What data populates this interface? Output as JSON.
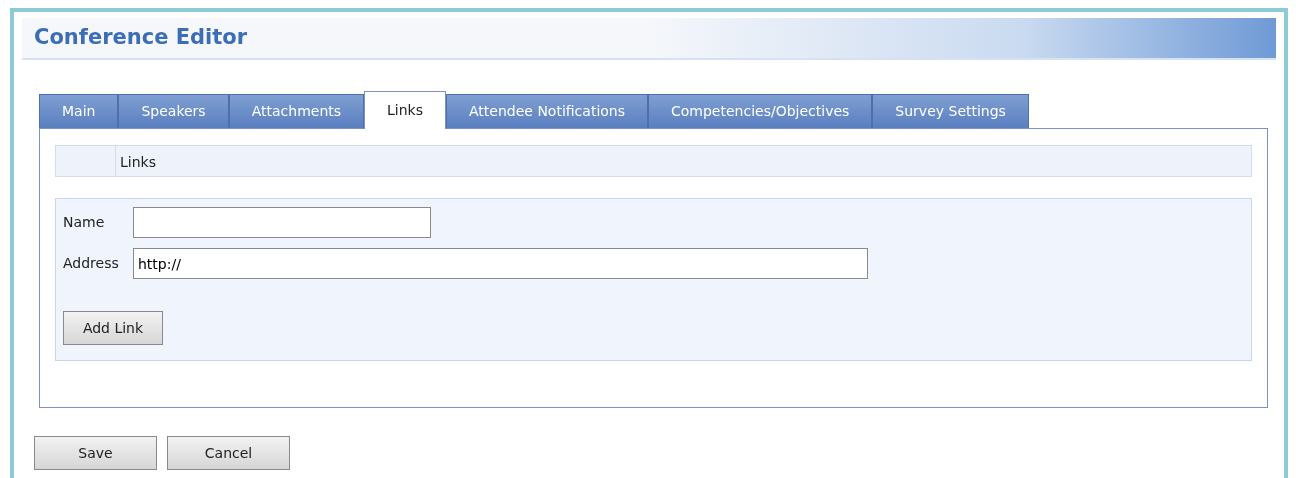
{
  "window": {
    "title": "Conference Editor"
  },
  "tabs": [
    {
      "label": "Main",
      "selected": false
    },
    {
      "label": "Speakers",
      "selected": false
    },
    {
      "label": "Attachments",
      "selected": false
    },
    {
      "label": "Links",
      "selected": true
    },
    {
      "label": "Attendee Notifications",
      "selected": false
    },
    {
      "label": "Competencies/Objectives",
      "selected": false
    },
    {
      "label": "Survey Settings",
      "selected": false
    }
  ],
  "section": {
    "title": "Links"
  },
  "form": {
    "fields": [
      {
        "label": "Name"
      },
      {
        "label": "Address",
        "value": "http://"
      }
    ],
    "button": "Add Link"
  },
  "buttons": [
    "Save",
    "Cancel"
  ]
}
